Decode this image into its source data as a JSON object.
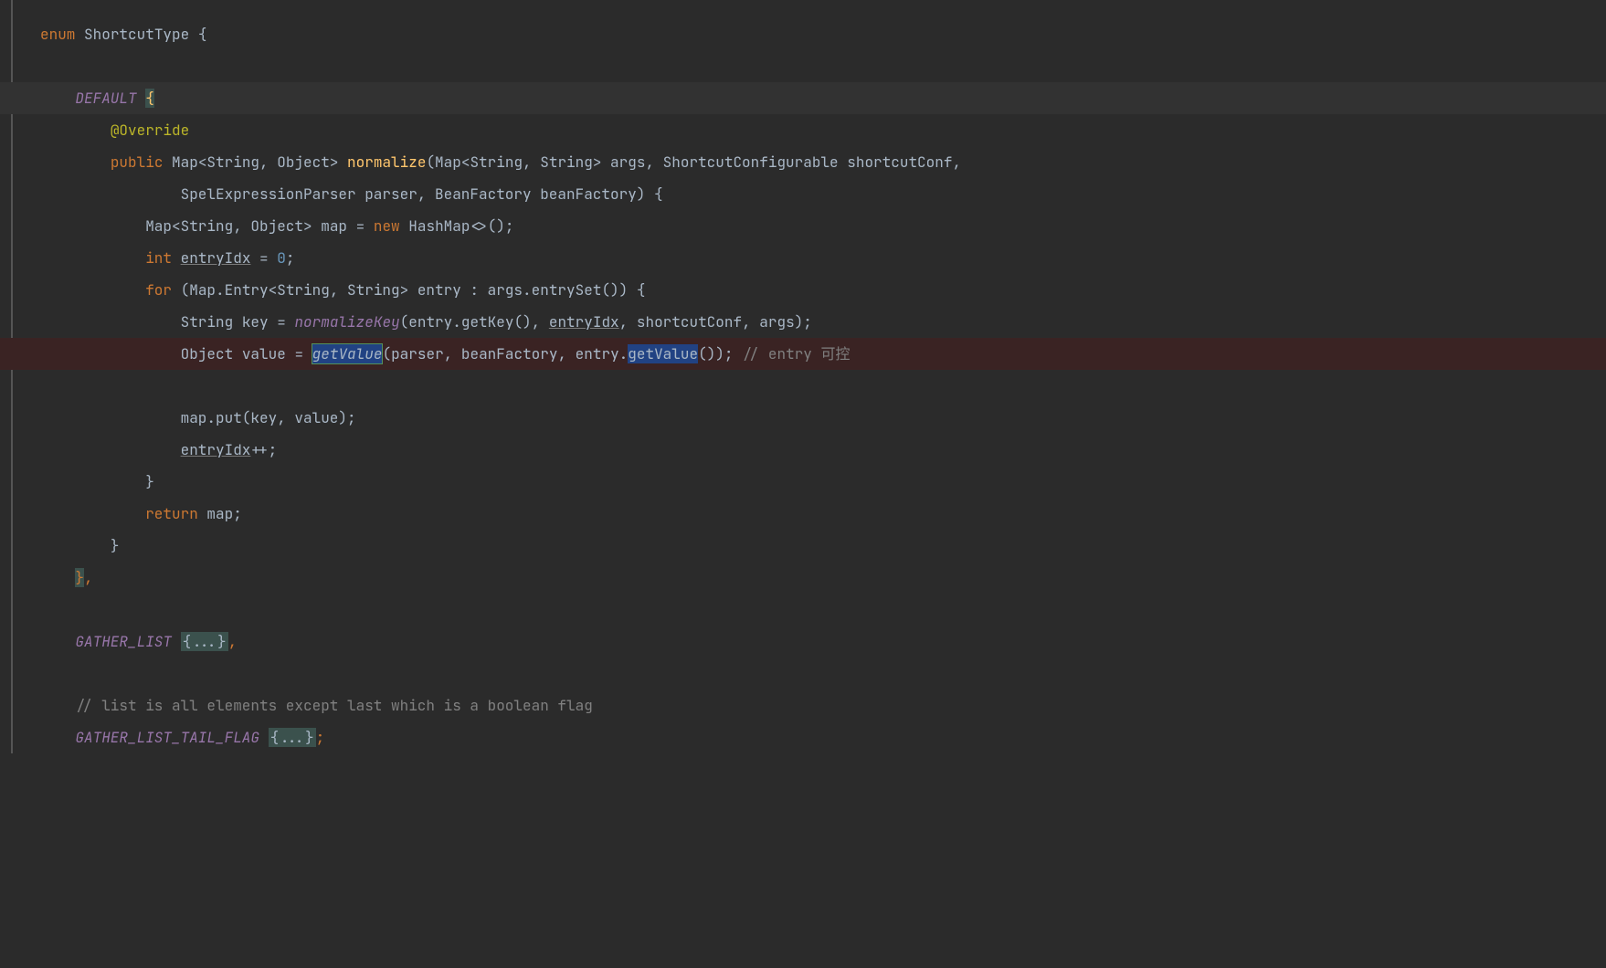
{
  "code": {
    "l1": {
      "kw": "enum",
      "name": "ShortcutType",
      "open": "{"
    },
    "l2": {
      "const": "DEFAULT",
      "brace": "{"
    },
    "l3": {
      "ann": "@Override"
    },
    "l4": {
      "kw": "public",
      "ret": "Map<String, Object>",
      "fn": "normalize",
      "sig1": "(Map<String, String> args, ShortcutConfigurable shortcutConf,"
    },
    "l5": {
      "sig2": "SpelExpressionParser parser, BeanFactory beanFactory) {"
    },
    "l6": {
      "type": "Map<String, Object>",
      "var": "map",
      "eq": "=",
      "kw": "new",
      "ctor": "HashMap<>();"
    },
    "l7": {
      "kw": "int",
      "var": "entryIdx",
      "eq": "= ",
      "num": "0",
      "tail": ";"
    },
    "l8": {
      "kw": "for",
      "head": "(Map.Entry<String, String> entry : args.entrySet()) {"
    },
    "l9": {
      "type": "String",
      "var": "key",
      "eq": "= ",
      "fn": "normalizeKey",
      "args_a": "(entry.getKey(), ",
      "u": "entryIdx",
      "args_b": ", shortcutConf, args);"
    },
    "l10": {
      "type": "Object",
      "var": "value",
      "eq": "= ",
      "sel": "getValue",
      "mid": "(parser, beanFactory, entry.",
      "sel2": "getValue",
      "tail": "()); ",
      "cmnt": "// entry 可控"
    },
    "l11": {
      "stmt": "map.put(key, value);"
    },
    "l12": {
      "u": "entryIdx",
      "tail": "++;"
    },
    "l13": {
      "brace": "}"
    },
    "l14": {
      "kw": "return",
      "var": "map",
      "tail": ";"
    },
    "l15": {
      "brace": "}"
    },
    "l16": {
      "brace": "}",
      "comma": ","
    },
    "l17": {
      "const": "GATHER_LIST",
      "fold": "{...}",
      "comma": ","
    },
    "l18": {
      "cmnt": "// list is all elements except last which is a boolean flag"
    },
    "l19": {
      "const": "GATHER_LIST_TAIL_FLAG",
      "fold": "{...}",
      "tail": ";"
    }
  }
}
